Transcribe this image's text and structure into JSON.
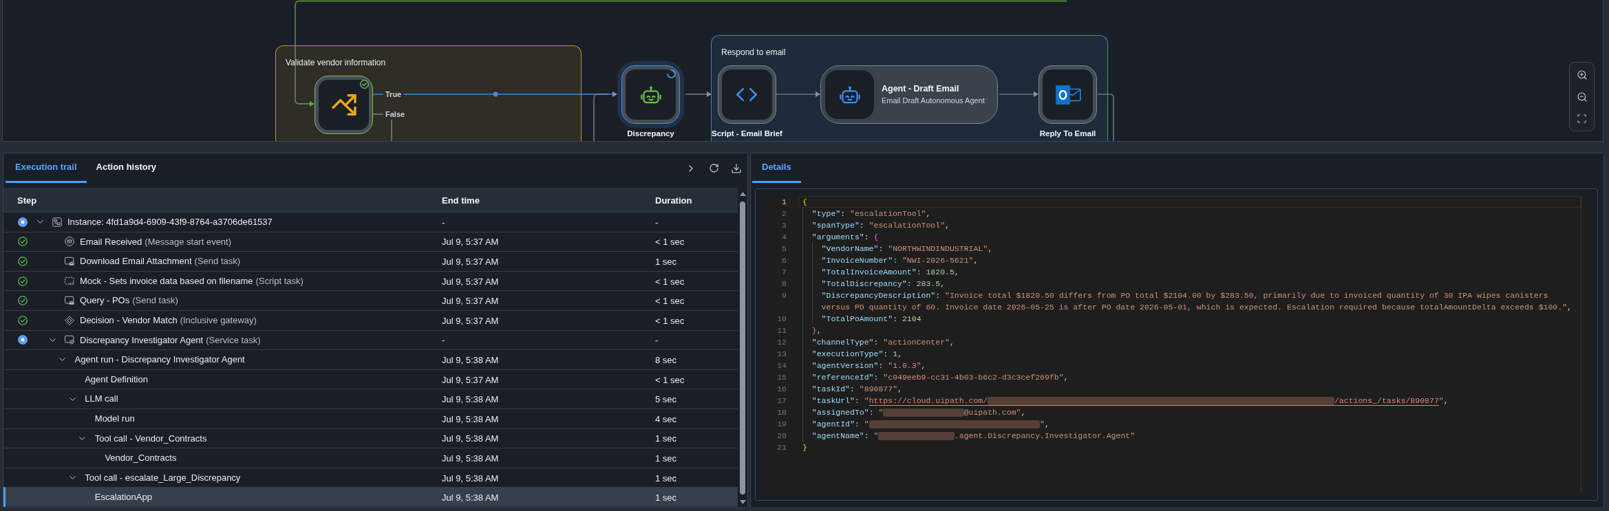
{
  "canvas": {
    "groups": [
      {
        "title": "Validate vendor information",
        "color": "#c9902c"
      },
      {
        "title": "Respond to email",
        "color": "#3c82d4"
      }
    ],
    "nodes": [
      {
        "kind": "gateway",
        "completed": true,
        "running": false,
        "outputs": [
          "True",
          "False"
        ]
      },
      {
        "kind": "agent",
        "completed": false,
        "running": true,
        "label": "Discrepancy"
      },
      {
        "kind": "script",
        "completed": false,
        "running": false,
        "label": "Script - Email Brief"
      },
      {
        "kind": "agent_card",
        "completed": false,
        "running": false,
        "title": "Agent - Draft Email",
        "subtitle": "Email Draft Autonomous Agent"
      },
      {
        "kind": "mail",
        "completed": false,
        "running": false,
        "label": "Reply To Email"
      }
    ]
  },
  "execution": {
    "tabs": [
      {
        "label": "Execution trail",
        "selected": true
      },
      {
        "label": "Action history",
        "selected": false
      }
    ],
    "columns": [
      "Step",
      "End time",
      "Duration"
    ],
    "rows": [
      {
        "completed": false,
        "kind": "process",
        "name": "Instance: 4fd1a9d4-6909-43f9-8764-a3706de61537",
        "end_time": "-",
        "duration": "-",
        "expanded": true,
        "selected": false,
        "children": [
          {
            "completed": true,
            "kind": "start_event",
            "name": "Email Received",
            "type": "(Message start event)",
            "end_time": "Jul 9, 5:37 AM",
            "duration": "< 1 sec",
            "selected": false
          },
          {
            "completed": true,
            "kind": "send_task",
            "name": "Download Email Attachment",
            "type": "(Send task)",
            "end_time": "Jul 9, 5:37 AM",
            "duration": "1 sec",
            "selected": false
          },
          {
            "completed": true,
            "kind": "script_task",
            "name": "Mock - Sets invoice data based on filename",
            "type": "(Script task)",
            "end_time": "Jul 9, 5:37 AM",
            "duration": "< 1 sec",
            "selected": false
          },
          {
            "completed": true,
            "kind": "send_task",
            "name": "Query - POs",
            "type": "(Send task)",
            "end_time": "Jul 9, 5:37 AM",
            "duration": "< 1 sec",
            "selected": false
          },
          {
            "completed": true,
            "kind": "gateway",
            "name": "Decision - Vendor Match",
            "type": "(Inclusive gateway)",
            "end_time": "Jul 9, 5:37 AM",
            "duration": "< 1 sec",
            "selected": false
          },
          {
            "completed": false,
            "kind": "service_task",
            "name": "Discrepancy Investigator Agent",
            "type": "(Service task)",
            "end_time": "-",
            "duration": "-",
            "expanded": true,
            "selected": false,
            "children": [
              {
                "name": "Agent run - Discrepancy Investigator Agent",
                "end_time": "Jul 9, 5:38 AM",
                "duration": "8 sec",
                "expanded": true,
                "selected": false,
                "children": [
                  {
                    "name": "Agent Definition",
                    "end_time": "Jul 9, 5:37 AM",
                    "duration": "< 1 sec",
                    "selected": false
                  },
                  {
                    "name": "LLM call",
                    "end_time": "Jul 9, 5:38 AM",
                    "duration": "5 sec",
                    "expanded": true,
                    "selected": false,
                    "children": [
                      {
                        "name": "Model run",
                        "end_time": "Jul 9, 5:38 AM",
                        "duration": "4 sec",
                        "selected": false
                      },
                      {
                        "name": "Tool call - Vendor_Contracts",
                        "end_time": "Jul 9, 5:38 AM",
                        "duration": "1 sec",
                        "expanded": true,
                        "selected": false,
                        "children": [
                          {
                            "name": "Vendor_Contracts",
                            "end_time": "Jul 9, 5:38 AM",
                            "duration": "1 sec",
                            "selected": false
                          }
                        ]
                      }
                    ]
                  },
                  {
                    "name": "Tool call - escalate_Large_Discrepancy",
                    "end_time": "Jul 9, 5:38 AM",
                    "duration": "1 sec",
                    "expanded": true,
                    "selected": false,
                    "children": [
                      {
                        "name": "EscalationApp",
                        "end_time": "Jul 9, 5:38 AM",
                        "duration": "1 sec",
                        "selected": true
                      }
                    ]
                  }
                ]
              }
            ]
          }
        ]
      }
    ]
  },
  "details": {
    "tabs": [
      {
        "label": "Details",
        "selected": true
      }
    ],
    "editor": {
      "lines": [
        {
          "number": "1",
          "current": true,
          "text": "{"
        },
        {
          "number": "2",
          "current": false,
          "text": "  \"type\": \"escalationTool\","
        },
        {
          "number": "3",
          "current": false,
          "text": "  \"spanType\": \"escalationTool\","
        },
        {
          "number": "4",
          "current": false,
          "text": "  \"arguments\": {"
        },
        {
          "number": "5",
          "current": false,
          "text": "    \"VendorName\": \"NORTHWINDINDUSTRIAL\","
        },
        {
          "number": "6",
          "current": false,
          "text": "    \"InvoiceNumber\": \"NWI-2026-5621\","
        },
        {
          "number": "7",
          "current": false,
          "text": "    \"TotalInvoiceAmount\": 1820.5,"
        },
        {
          "number": "8",
          "current": false,
          "text": "    \"TotalDiscrepancy\": 283.5,"
        },
        {
          "number": "9",
          "current": false,
          "text": "    \"DiscrepancyDescription\": \"Invoice total $1820.50 differs from PO total $2104.00 by $283.50, primarily due to invoiced quantity of 30 IPA wipes canisters versus PO quantity of 60. Invoice date 2026-05-25 is after PO date 2026-05-01, which is expected. Escalation required because totalAmountDelta exceeds $100.\","
        },
        {
          "number": "10",
          "current": false,
          "text": "    \"TotalPoAmount\": 2104"
        },
        {
          "number": "11",
          "current": false,
          "text": "  },"
        },
        {
          "number": "12",
          "current": false,
          "text": "  \"channelType\": \"actionCenter\","
        },
        {
          "number": "13",
          "current": false,
          "text": "  \"executionType\": 1,"
        },
        {
          "number": "14",
          "current": false,
          "text": "  \"agentVersion\": \"1.0.3\","
        },
        {
          "number": "15",
          "current": false,
          "text": "  \"referenceId\": \"c049eeb9-cc31-4b03-b6c2-d3c3cef269fb\","
        },
        {
          "number": "16",
          "current": false,
          "text": "  \"taskId\": \"890877\","
        },
        {
          "number": "17",
          "current": false,
          "parts": [
            {
              "kind": "text",
              "text": "  \"taskUrl\": \""
            },
            {
              "kind": "link",
              "text": "https://cloud.uipath.com/"
            },
            {
              "kind": "redacted"
            },
            {
              "kind": "link",
              "text": "/actions_/tasks/890877"
            },
            {
              "kind": "text",
              "text": "\","
            }
          ]
        },
        {
          "number": "18",
          "current": false,
          "parts": [
            {
              "kind": "text",
              "text": "  \"assignedTo\": \""
            },
            {
              "kind": "redacted"
            },
            {
              "kind": "text",
              "text": "@uipath.com\","
            }
          ]
        },
        {
          "number": "19",
          "current": false,
          "parts": [
            {
              "kind": "text",
              "text": "  \"agentId\": \""
            },
            {
              "kind": "redacted"
            },
            {
              "kind": "text",
              "text": "\","
            }
          ]
        },
        {
          "number": "20",
          "current": false,
          "parts": [
            {
              "kind": "text",
              "text": "  \"agentName\": \""
            },
            {
              "kind": "redacted"
            },
            {
              "kind": "text",
              "text": ".agent.Discrepancy.Investigator.Agent\""
            }
          ]
        },
        {
          "number": "21",
          "current": false,
          "text": "}"
        }
      ]
    }
  }
}
